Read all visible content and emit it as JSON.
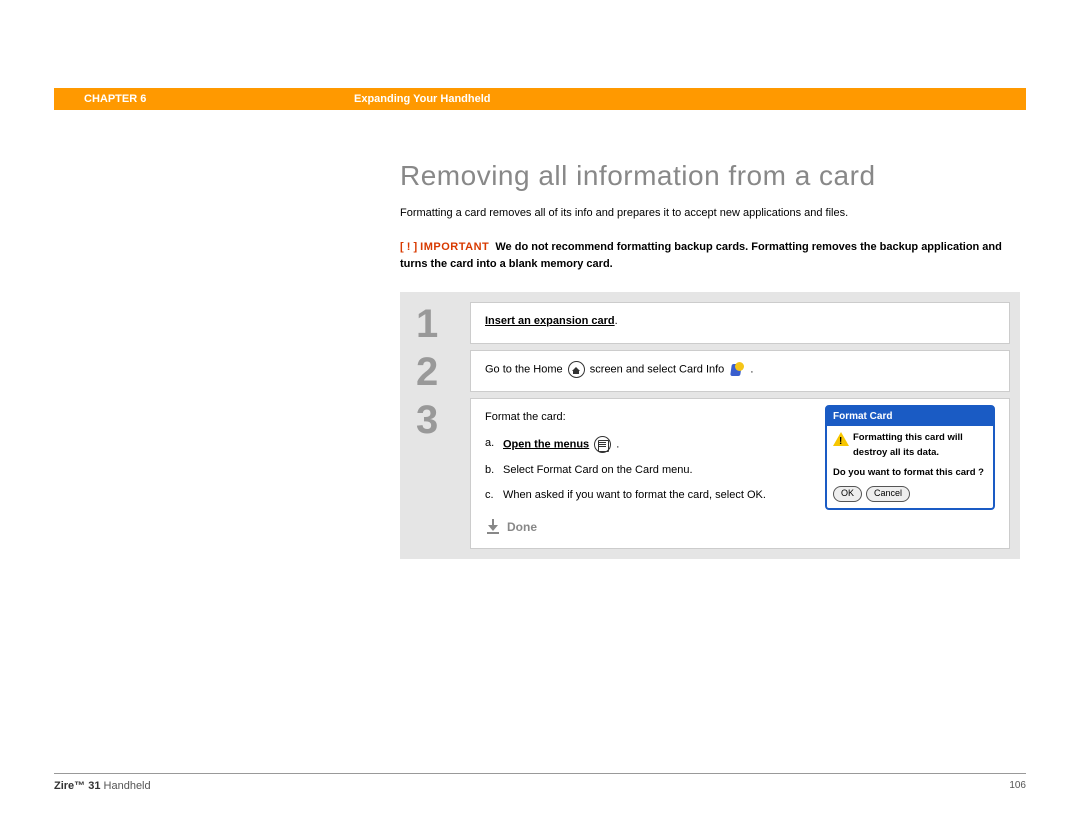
{
  "header": {
    "chapter": "CHAPTER 6",
    "section": "Expanding Your Handheld"
  },
  "title": "Removing all information from a card",
  "intro": "Formatting a card removes all of its info and prepares it to accept new applications and files.",
  "important": {
    "marker": "[ ! ]",
    "label": "IMPORTANT",
    "text": "We do not recommend formatting backup cards. Formatting removes the backup application and turns the card into a blank memory card."
  },
  "steps": {
    "s1": {
      "num": "1",
      "link": "Insert an expansion card",
      "suffix": "."
    },
    "s2": {
      "num": "2",
      "pre": "Go to the Home ",
      "mid": " screen and select Card Info ",
      "post": " ."
    },
    "s3": {
      "num": "3",
      "lead": "Format the card:",
      "a_letter": "a.",
      "a_text": "Open the menus",
      "a_suffix": " .",
      "b_letter": "b.",
      "b_text": "Select Format Card on the Card menu.",
      "c_letter": "c.",
      "c_text": "When asked if you want to format the card, select OK.",
      "done": "Done",
      "dialog": {
        "title": "Format Card",
        "line1": "Formatting this card will destroy all its data.",
        "line2": "Do you want to format this card ?",
        "ok": "OK",
        "cancel": "Cancel"
      }
    }
  },
  "footer": {
    "product_bold": "Zire™ 31",
    "product_rest": " Handheld",
    "page": "106"
  }
}
